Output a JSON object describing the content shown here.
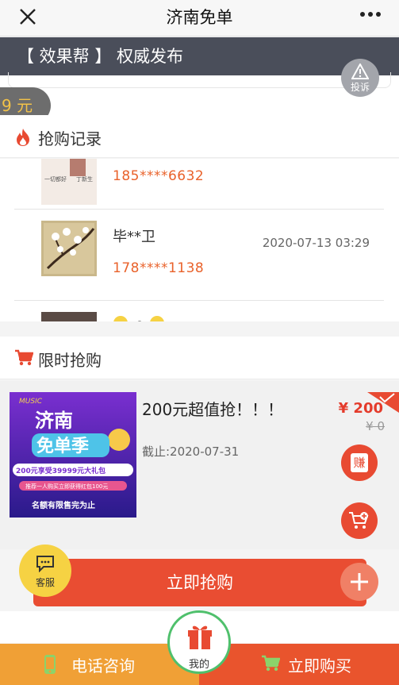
{
  "header": {
    "title": "济南免单"
  },
  "banner": {
    "text": "【 效果帮 】  权威发布"
  },
  "complain": {
    "label": "投诉"
  },
  "price_pill": {
    "text": "9 元"
  },
  "records": {
    "title": "抢购记录",
    "items": [
      {
        "name": "",
        "time": "",
        "phone": "185****6632"
      },
      {
        "name": "毕**卫",
        "time": "2020-07-13 03:29",
        "phone": "178****1138"
      },
      {
        "name": "",
        "time": "",
        "phone": ""
      }
    ],
    "thumb_text": {
      "a": "一切都好",
      "b": "丁新生"
    }
  },
  "flash": {
    "title": "限时抢购"
  },
  "product": {
    "title": "200元超值抢！！！",
    "deadline": "截止:2020-07-31",
    "price": "¥ 200",
    "old_price": "¥ 0",
    "earn_label": "赚",
    "poster": {
      "music": "MUSIC",
      "line1": "济南",
      "line2": "免单季",
      "line3": "200元享受39999元大礼包",
      "line4": "推荐一人购买立即获得红包100元",
      "line5": "名额有限售完为止"
    }
  },
  "buy_button": {
    "label": "立即抢购"
  },
  "service": {
    "label": "客服"
  },
  "bottom": {
    "phone_label": "电话咨询",
    "mine_label": "我的",
    "buy_label": "立即购买"
  },
  "colors": {
    "accent": "#e94d32",
    "orange": "#f0a036",
    "phone_red": "#e9622b",
    "green": "#4fc06c"
  }
}
